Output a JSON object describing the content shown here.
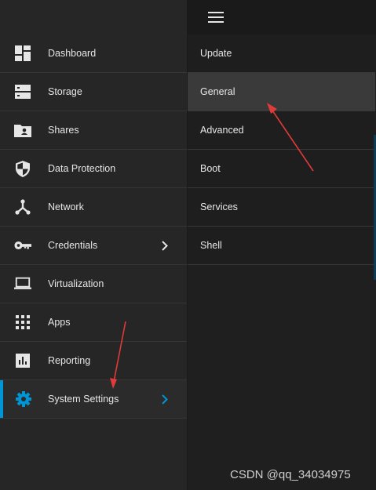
{
  "sidebar": {
    "items": [
      {
        "label": "Dashboard",
        "icon": "dashboard-icon"
      },
      {
        "label": "Storage",
        "icon": "storage-icon"
      },
      {
        "label": "Shares",
        "icon": "shares-icon"
      },
      {
        "label": "Data Protection",
        "icon": "shield-icon"
      },
      {
        "label": "Network",
        "icon": "network-icon"
      },
      {
        "label": "Credentials",
        "icon": "key-icon"
      },
      {
        "label": "Virtualization",
        "icon": "monitor-icon"
      },
      {
        "label": "Apps",
        "icon": "apps-grid-icon"
      },
      {
        "label": "Reporting",
        "icon": "chart-icon"
      },
      {
        "label": "System Settings",
        "icon": "gear-icon"
      }
    ],
    "active_item": "System Settings",
    "accent_color": "#0095d5"
  },
  "submenu": {
    "items": [
      "Update",
      "General",
      "Advanced",
      "Boot",
      "Services",
      "Shell"
    ],
    "highlighted": "General"
  },
  "watermark": "CSDN @qq_34034975"
}
